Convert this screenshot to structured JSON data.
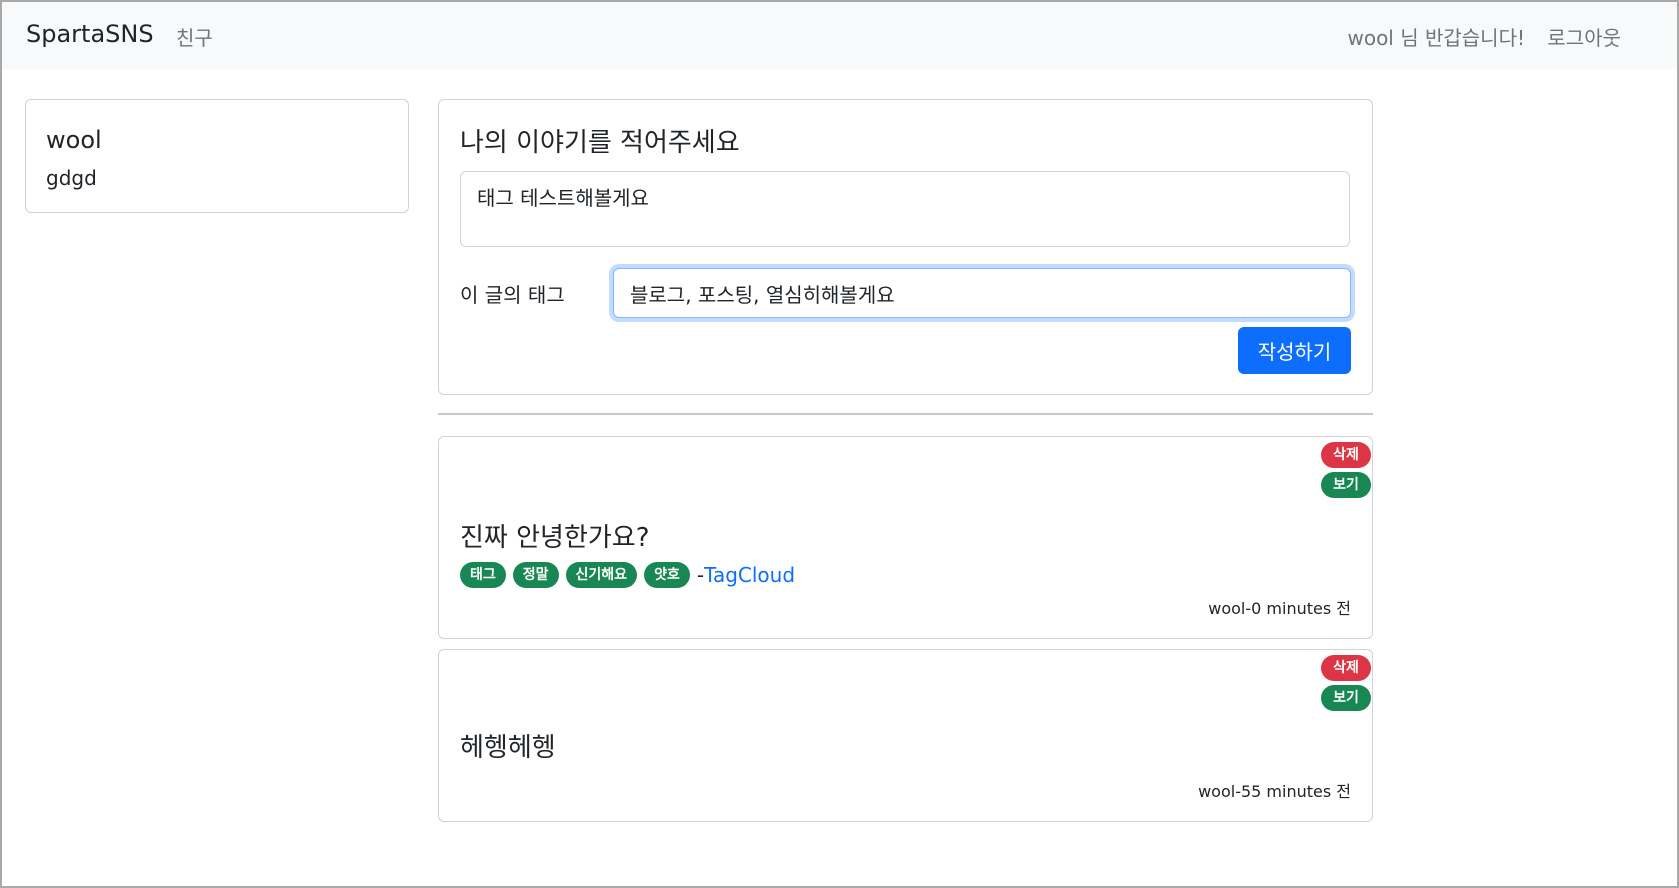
{
  "navbar": {
    "brand": "SpartaSNS",
    "friends_link": "친구",
    "greeting": "wool 님 반갑습니다!",
    "logout": "로그아웃"
  },
  "profile": {
    "username": "wool",
    "bio": "gdgd"
  },
  "composer": {
    "title": "나의 이야기를 적어주세요",
    "content_value": "태그 테스트해볼게요",
    "tag_label": "이 글의 태그",
    "tag_value": "블로그, 포스팅, 열심히해볼게요",
    "submit_label": "작성하기"
  },
  "posts": [
    {
      "delete_label": "삭제",
      "view_label": "보기",
      "title": "진짜 안녕한가요?",
      "tags": [
        "태그",
        "정말",
        "신기해요",
        "얏호"
      ],
      "tag_separator": "-",
      "tagcloud_link": "TagCloud",
      "meta": "wool-0 minutes 전"
    },
    {
      "delete_label": "삭제",
      "view_label": "보기",
      "title": "헤헹헤헹",
      "meta": "wool-55 minutes 전"
    }
  ],
  "colors": {
    "primary": "#0d6efd",
    "danger": "#dc3545",
    "success": "#198754",
    "navbar_bg": "#f8f9fa"
  }
}
